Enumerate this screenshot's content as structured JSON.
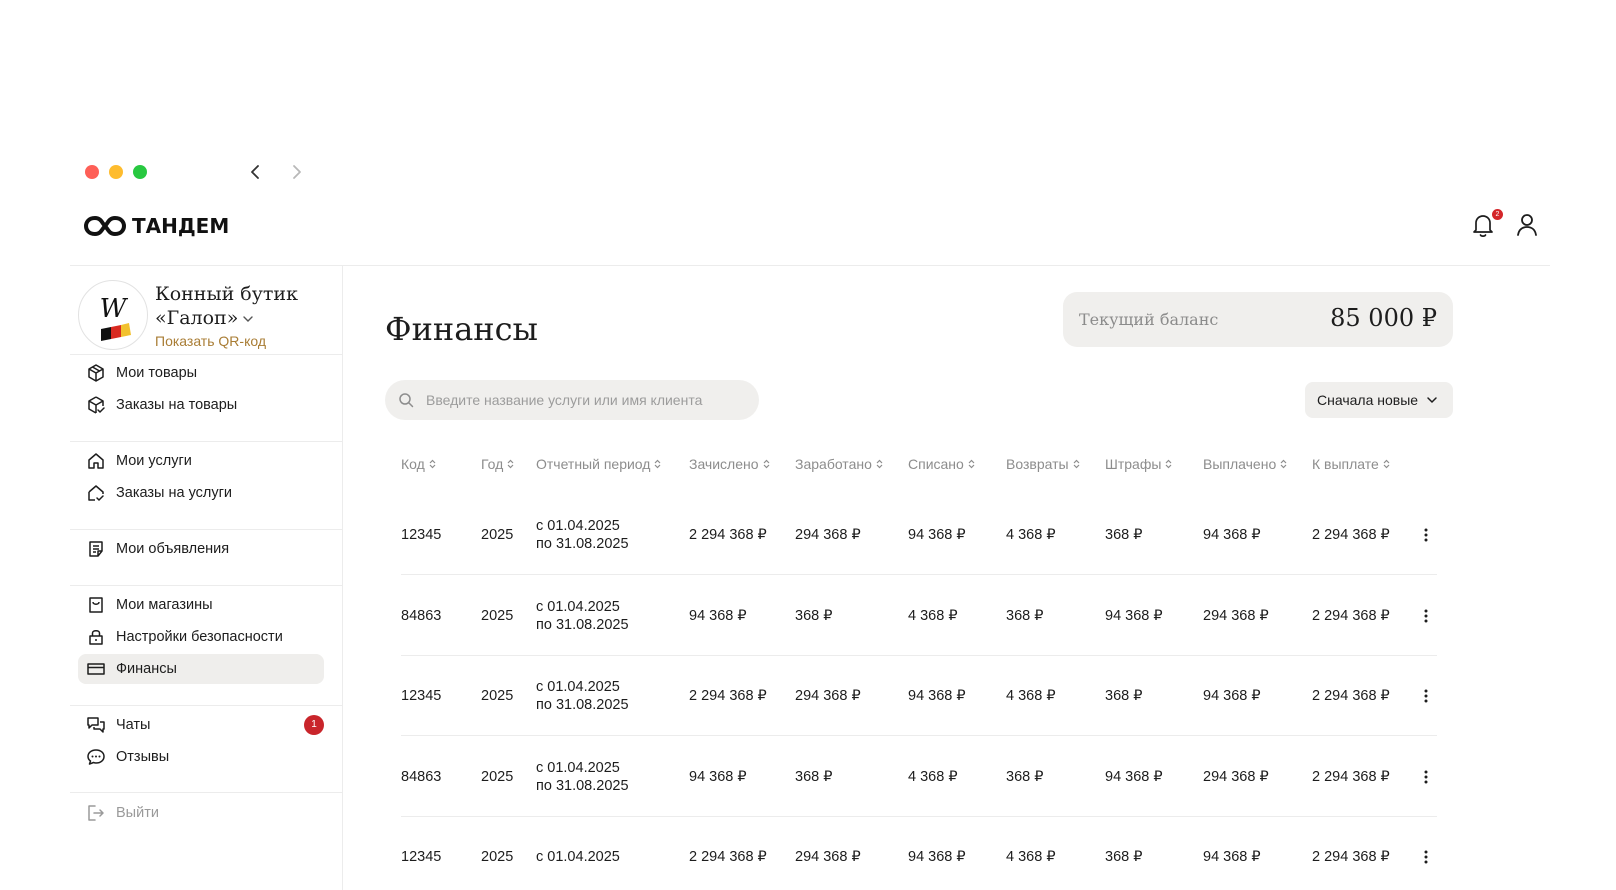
{
  "app": {
    "logo_text": "ТАНДЕМ",
    "notifications_count": "2"
  },
  "shop": {
    "name": "Конный бутик «Галоп»",
    "qr_link": "Показать QR-код"
  },
  "sidebar": {
    "groups": [
      [
        {
          "label": "Мои товары",
          "icon": "box-icon"
        },
        {
          "label": "Заказы на товары",
          "icon": "box-check-icon"
        }
      ],
      [
        {
          "label": "Мои услуги",
          "icon": "house-icon"
        },
        {
          "label": "Заказы на услуги",
          "icon": "house-check-icon"
        }
      ],
      [
        {
          "label": "Мои объявления",
          "icon": "listing-icon"
        }
      ],
      [
        {
          "label": "Мои магазины",
          "icon": "shopping-bag-icon"
        },
        {
          "label": "Настройки безопасности",
          "icon": "lock-icon"
        },
        {
          "label": "Финансы",
          "icon": "card-icon",
          "active": true
        }
      ],
      [
        {
          "label": "Чаты",
          "icon": "chats-icon",
          "badge": "1"
        },
        {
          "label": "Отзывы",
          "icon": "review-icon"
        }
      ]
    ],
    "logout_label": "Выйти"
  },
  "main": {
    "title": "Финансы",
    "balance_label": "Текущий баланс",
    "balance_value": "85 000 ₽",
    "search_placeholder": "Введите название услуги или имя клиента",
    "sort_label": "Сначала новые"
  },
  "table": {
    "columns": [
      "Код",
      "Год",
      "Отчетный период",
      "Зачислено",
      "Заработано",
      "Списано",
      "Возвраты",
      "Штрафы",
      "Выплачено",
      "К выплате"
    ],
    "rows": [
      {
        "code": "12345",
        "year": "2025",
        "period_from": "с 01.04.2025",
        "period_to": "по 31.08.2025",
        "credited": "2 294 368 ₽",
        "earned": "294 368 ₽",
        "written_off": "94 368 ₽",
        "returns": "4 368 ₽",
        "fines": "368 ₽",
        "paid": "94 368 ₽",
        "to_pay": "2 294 368 ₽"
      },
      {
        "code": "84863",
        "year": "2025",
        "period_from": "с 01.04.2025",
        "period_to": "по 31.08.2025",
        "credited": "94 368 ₽",
        "earned": "368 ₽",
        "written_off": "4 368 ₽",
        "returns": "368 ₽",
        "fines": "94 368 ₽",
        "paid": "294 368 ₽",
        "to_pay": "2 294 368 ₽"
      },
      {
        "code": "12345",
        "year": "2025",
        "period_from": "с 01.04.2025",
        "period_to": "по 31.08.2025",
        "credited": "2 294 368 ₽",
        "earned": "294 368 ₽",
        "written_off": "94 368 ₽",
        "returns": "4 368 ₽",
        "fines": "368 ₽",
        "paid": "94 368 ₽",
        "to_pay": "2 294 368 ₽"
      },
      {
        "code": "84863",
        "year": "2025",
        "period_from": "с 01.04.2025",
        "period_to": "по 31.08.2025",
        "credited": "94 368 ₽",
        "earned": "368 ₽",
        "written_off": "4 368 ₽",
        "returns": "368 ₽",
        "fines": "94 368 ₽",
        "paid": "294 368 ₽",
        "to_pay": "2 294 368 ₽"
      },
      {
        "code": "12345",
        "year": "2025",
        "period_from": "с 01.04.2025",
        "period_to": "",
        "credited": "2 294 368 ₽",
        "earned": "294 368 ₽",
        "written_off": "94 368 ₽",
        "returns": "4 368 ₽",
        "fines": "368 ₽",
        "paid": "94 368 ₽",
        "to_pay": "2 294 368 ₽"
      }
    ]
  },
  "colors": {
    "accent_gold": "#a97d35",
    "badge_red": "#c9252b",
    "active_bg": "#efeeec"
  }
}
